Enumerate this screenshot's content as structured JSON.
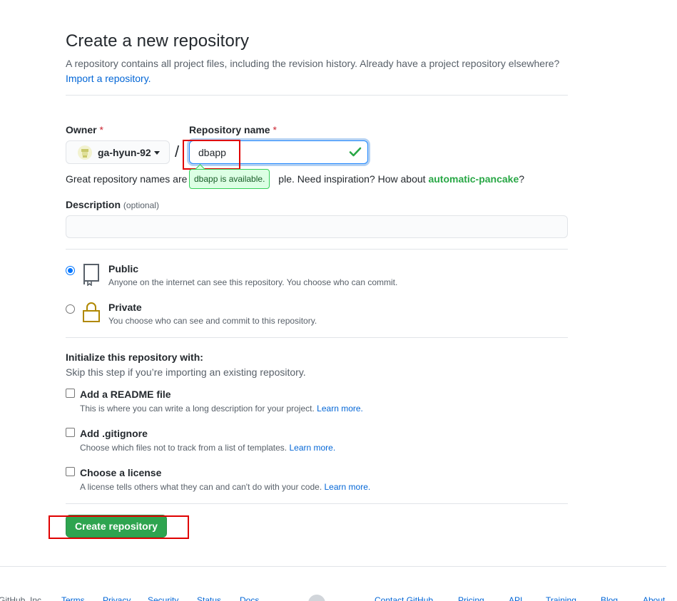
{
  "header": {
    "title": "Create a new repository",
    "subtitle": "A repository contains all project files, including the revision history. Already have a project repository elsewhere?",
    "import_link": "Import a repository."
  },
  "owner": {
    "label": "Owner",
    "required_mark": "*",
    "value": "ga-hyun-92"
  },
  "repo_name": {
    "label": "Repository name",
    "required_mark": "*",
    "value": "dbapp",
    "separator": "/",
    "tooltip": "dbapp is available."
  },
  "hint": {
    "prefix": "Great repository names are s",
    "middle": "ple. Need inspiration? How about ",
    "suggestion": "automatic-pancake",
    "suffix": "?"
  },
  "description": {
    "label": "Description",
    "optional": "(optional)",
    "value": ""
  },
  "visibility": [
    {
      "title": "Public",
      "desc": "Anyone on the internet can see this repository. You choose who can commit.",
      "checked": true
    },
    {
      "title": "Private",
      "desc": "You choose who can see and commit to this repository.",
      "checked": false
    }
  ],
  "init": {
    "title": "Initialize this repository with:",
    "subtitle": "Skip this step if you’re importing an existing repository.",
    "options": [
      {
        "title": "Add a README file",
        "desc": "This is where you can write a long description for your project.",
        "link": "Learn more."
      },
      {
        "title": "Add .gitignore",
        "desc": "Choose which files not to track from a list of templates.",
        "link": "Learn more."
      },
      {
        "title": "Choose a license",
        "desc": "A license tells others what they can and can't do with your code.",
        "link": "Learn more."
      }
    ]
  },
  "submit": {
    "label": "Create repository"
  },
  "colors": {
    "accent": "#0366d6",
    "success": "#2ea44f",
    "highlight_red": "#e00000"
  },
  "footer": {
    "items": [
      "GitHub, Inc.",
      "Terms",
      "Privacy",
      "Security",
      "Status",
      "Docs",
      "Contact GitHub",
      "Pricing",
      "API",
      "Training",
      "Blog",
      "About"
    ]
  }
}
